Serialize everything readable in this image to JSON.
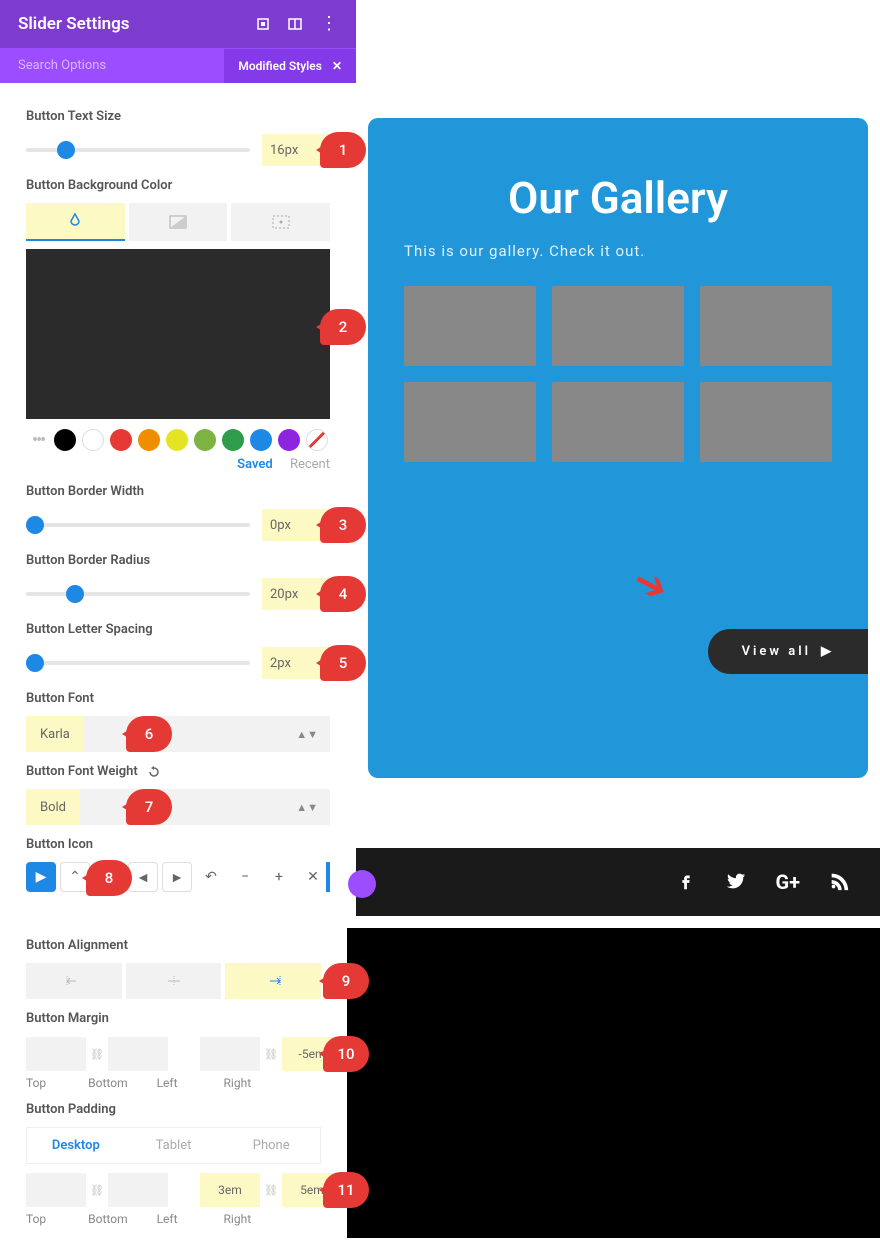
{
  "panel": {
    "title": "Slider Settings",
    "search": "Search Options",
    "filter": "Modified Styles",
    "sections": {
      "textSize": {
        "label": "Button Text Size",
        "value": "16px",
        "thumb": 14
      },
      "bgColor": {
        "label": "Button Background Color"
      },
      "saved": "Saved",
      "recent": "Recent",
      "borderWidth": {
        "label": "Button Border Width",
        "value": "0px",
        "thumb": 0
      },
      "borderRadius": {
        "label": "Button Border Radius",
        "value": "20px",
        "thumb": 18
      },
      "letterSpacing": {
        "label": "Button Letter Spacing",
        "value": "2px",
        "thumb": 0
      },
      "font": {
        "label": "Button Font",
        "value": "Karla"
      },
      "fontWeight": {
        "label": "Button Font Weight",
        "value": "Bold"
      },
      "icon": {
        "label": "Button Icon"
      },
      "alignment": {
        "label": "Button Alignment"
      },
      "margin": {
        "label": "Button Margin",
        "top": "",
        "bottom": "",
        "left": "",
        "right": "-5em",
        "labels": [
          "Top",
          "Bottom",
          "Left",
          "Right"
        ]
      },
      "padding": {
        "label": "Button Padding",
        "devices": [
          "Desktop",
          "Tablet",
          "Phone"
        ],
        "top": "",
        "bottom": "",
        "left": "3em",
        "right": "5em",
        "labels": [
          "Top",
          "Bottom",
          "Left",
          "Right"
        ]
      }
    }
  },
  "swatches": [
    "#000000",
    "#ffffff",
    "#e53935",
    "#ef6c00",
    "#fdd835",
    "#7cb342",
    "#43a047",
    "#1e88e5",
    "#8e24aa"
  ],
  "callouts": [
    "1",
    "2",
    "3",
    "4",
    "5",
    "6",
    "7",
    "8",
    "9",
    "10",
    "11"
  ],
  "preview": {
    "title": "Our Gallery",
    "subtitle": "This is our gallery. Check it out.",
    "button": "View all"
  }
}
